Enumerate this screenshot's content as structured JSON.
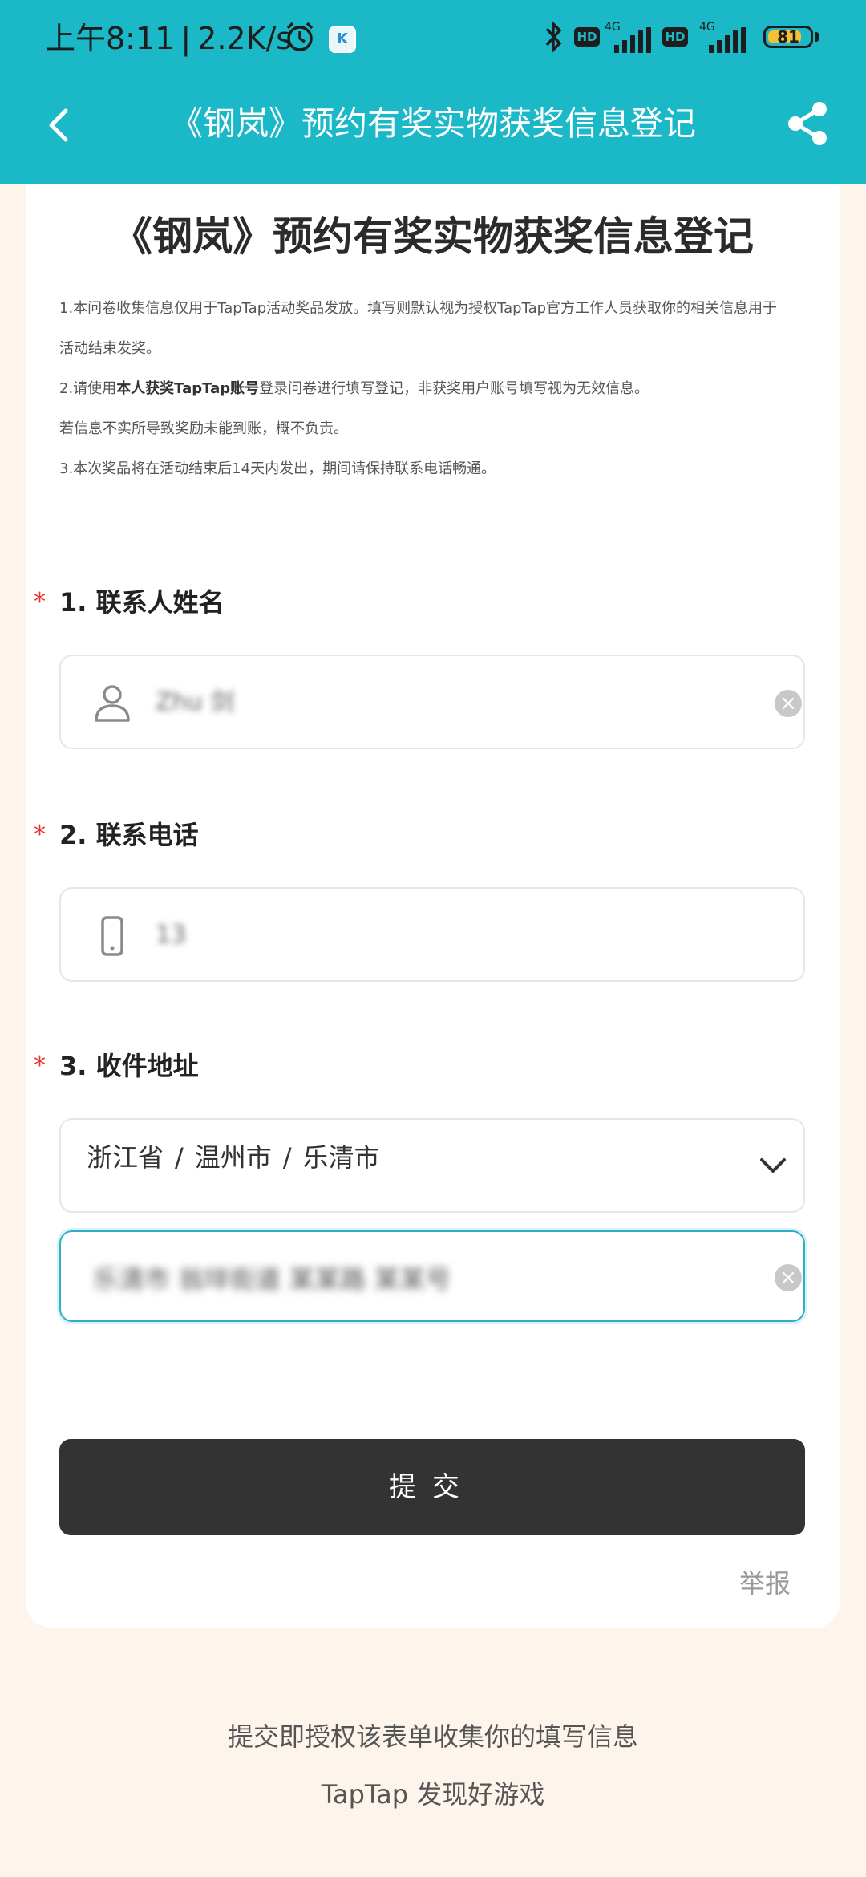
{
  "status_bar": {
    "time": "上午8:11",
    "speed": "2.2K/s",
    "network_1": "4G",
    "network_2": "4G",
    "hd_1": "HD",
    "hd_2": "HD",
    "battery": "81",
    "battery_level": 0.81,
    "k_app_letter": "K"
  },
  "app_bar": {
    "title": "《钢岚》预约有奖实物获奖信息登记"
  },
  "form": {
    "title": "《钢岚》预约有奖实物获奖信息登记",
    "notes": {
      "line1": "1.本问卷收集信息仅用于TapTap活动奖品发放。填写则默认视为授权TapTap官方工作人员获取你的相关信息用于",
      "line2": "活动结束发奖。",
      "line3_prefix": "2.请使用",
      "line3_bold": "本人获奖TapTap账号",
      "line3_suffix": "登录问卷进行填写登记，非获奖用户账号填写视为无效信息。",
      "line4": "若信息不实所导致奖励未能到账，概不负责。",
      "line5": "3.本次奖品将在活动结束后14天内发出，期间请保持联系电话畅通。"
    },
    "questions": [
      {
        "required_mark": "*",
        "label": "1. 联系人姓名",
        "value": "Zhu 剑",
        "clear": "×"
      },
      {
        "required_mark": "*",
        "label": "2. 联系电话",
        "value": "13"
      },
      {
        "required_mark": "*",
        "label": "3. 收件地址",
        "province": "浙江省",
        "city": "温州市",
        "district": "乐清市",
        "separator": "/",
        "address_value": "乐清市 翁垟街道 某某路 某某号",
        "clear": "×"
      }
    ],
    "submit_label": "提交",
    "report_label": "举报"
  },
  "footer": {
    "line1": "提交即授权该表单收集你的填写信息",
    "line2": "TapTap 发现好游戏"
  },
  "colors": {
    "header_teal": "#1bb8c8",
    "required_red": "#e53935",
    "submit_dark": "#333333",
    "focus_border": "#2fb0c8",
    "page_bg": "#fdf5ec"
  }
}
